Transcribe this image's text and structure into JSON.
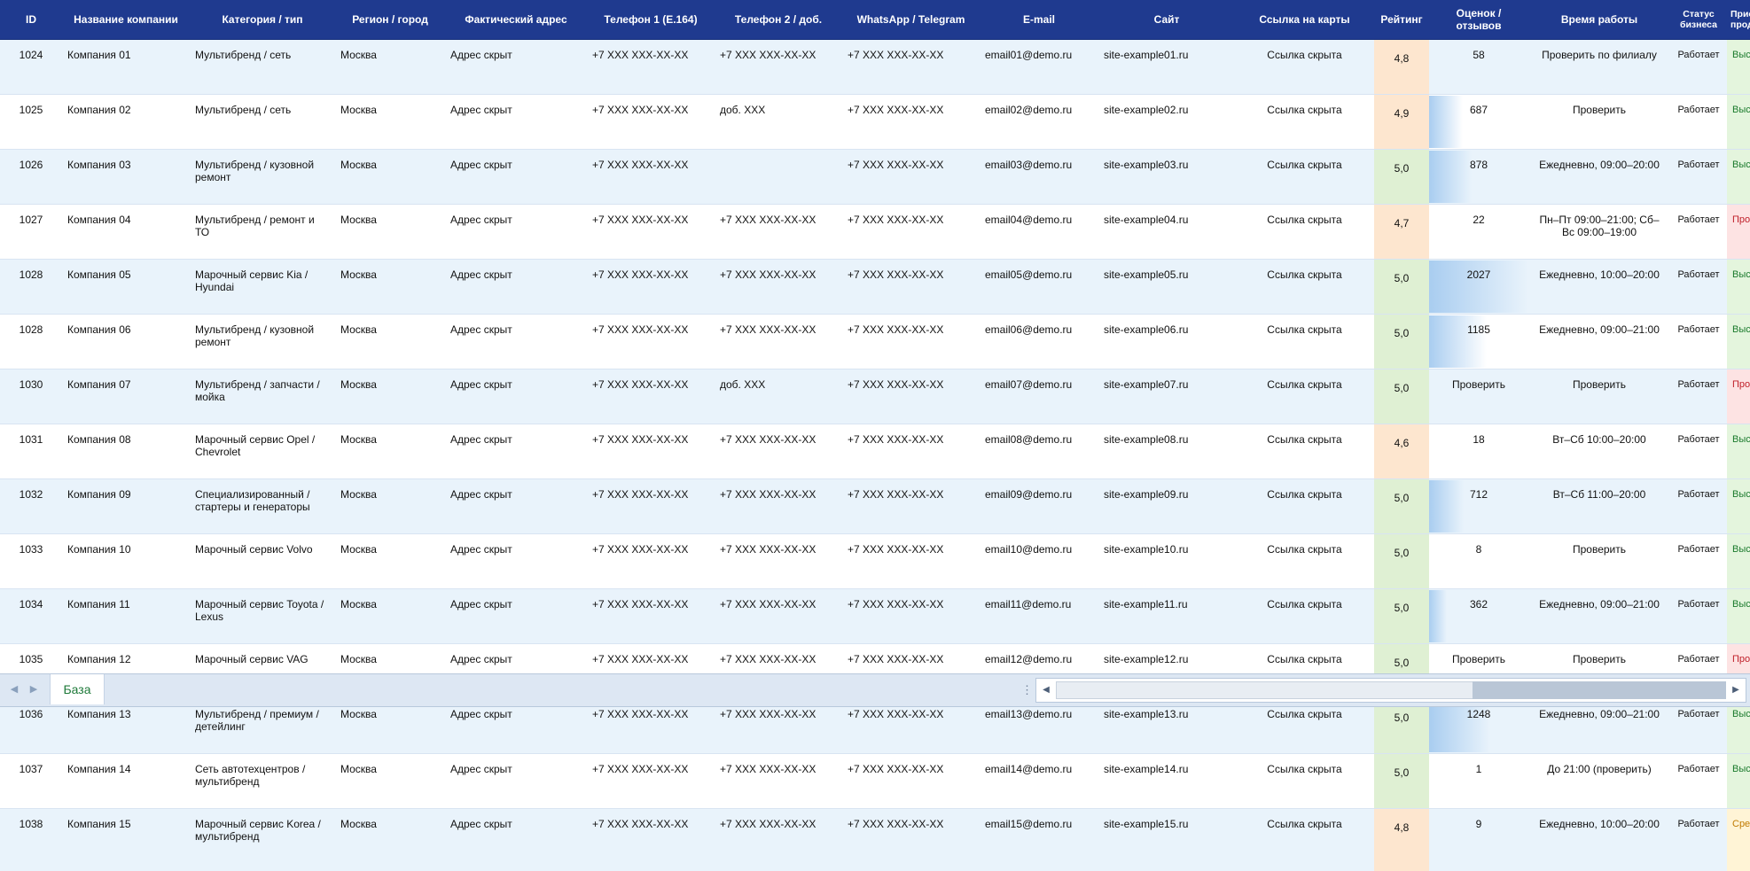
{
  "headers": [
    "ID",
    "Название компании",
    "Категория / тип",
    "Регион / город",
    "Фактический адрес",
    "Телефон 1 (E.164)",
    "Телефон 2 / доб.",
    "WhatsApp / Telegram",
    "E-mail",
    "Сайт",
    "Ссылка на карты",
    "Рейтинг",
    "Оценок / отзывов",
    "Время работы",
    "Статус бизнеса",
    "Приоритет продаж"
  ],
  "rows": [
    {
      "id": "1024",
      "name": "Компания 01",
      "category": "Мультибренд / сеть",
      "region": "Москва",
      "address": "Адрес скрыт",
      "phone1": "+7 XXX XXX-XX-XX",
      "phone2": "+7 XXX XXX-XX-XX",
      "messenger": "+7 XXX XXX-XX-XX",
      "email": "email01@demo.ru",
      "site": "site-example01.ru",
      "map": "Ссылка скрыта",
      "rating": "4,8",
      "rating_level": "warn",
      "reviews": "58",
      "reviews_fill": 0.0,
      "hours": "Проверить по филиалу",
      "status": "Работает",
      "priority": "Высокий",
      "priority_level": "high"
    },
    {
      "id": "1025",
      "name": "Компания 02",
      "category": "Мультибренд / сеть",
      "region": "Москва",
      "address": "Адрес скрыт",
      "phone1": "+7 XXX XXX-XX-XX",
      "phone2": "доб. XXX",
      "messenger": "+7 XXX XXX-XX-XX",
      "email": "email02@demo.ru",
      "site": "site-example02.ru",
      "map": "Ссылка скрыта",
      "rating": "4,9",
      "rating_level": "warn",
      "reviews": "687",
      "reviews_fill": 0.34,
      "hours": "Проверить",
      "status": "Работает",
      "priority": "Высокий",
      "priority_level": "high"
    },
    {
      "id": "1026",
      "name": "Компания 03",
      "category": "Мультибренд / кузовной ремонт",
      "region": "Москва",
      "address": "Адрес скрыт",
      "phone1": "+7 XXX XXX-XX-XX",
      "phone2": "",
      "messenger": "+7 XXX XXX-XX-XX",
      "email": "email03@demo.ru",
      "site": "site-example03.ru",
      "map": "Ссылка скрыта",
      "rating": "5,0",
      "rating_level": "good",
      "reviews": "878",
      "reviews_fill": 0.43,
      "hours": "Ежедневно, 09:00–20:00",
      "status": "Работает",
      "priority": "Высокий",
      "priority_level": "high"
    },
    {
      "id": "1027",
      "name": "Компания 04",
      "category": "Мультибренд / ремонт и ТО",
      "region": "Москва",
      "address": "Адрес скрыт",
      "phone1": "+7 XXX XXX-XX-XX",
      "phone2": "+7 XXX XXX-XX-XX",
      "messenger": "+7 XXX XXX-XX-XX",
      "email": "email04@demo.ru",
      "site": "site-example04.ru",
      "map": "Ссылка скрыта",
      "rating": "4,7",
      "rating_level": "warn",
      "reviews": "22",
      "reviews_fill": 0.0,
      "hours": "Пн–Пт 09:00–21:00; Сб–Вс 09:00–19:00",
      "status": "Работает",
      "priority": "Проверить",
      "priority_level": "check"
    },
    {
      "id": "1028",
      "name": "Компания 05",
      "category": "Марочный сервис Kia / Hyundai",
      "region": "Москва",
      "address": "Адрес скрыт",
      "phone1": "+7 XXX XXX-XX-XX",
      "phone2": "+7 XXX XXX-XX-XX",
      "messenger": "+7 XXX XXX-XX-XX",
      "email": "email05@demo.ru",
      "site": "site-example05.ru",
      "map": "Ссылка скрыта",
      "rating": "5,0",
      "rating_level": "good",
      "reviews": "2027",
      "reviews_fill": 1.0,
      "hours": "Ежедневно, 10:00–20:00",
      "status": "Работает",
      "priority": "Высокий",
      "priority_level": "high"
    },
    {
      "id": "1028",
      "name": "Компания 06",
      "category": "Мультибренд / кузовной ремонт",
      "region": "Москва",
      "address": "Адрес скрыт",
      "phone1": "+7 XXX XXX-XX-XX",
      "phone2": "+7 XXX XXX-XX-XX",
      "messenger": "+7 XXX XXX-XX-XX",
      "email": "email06@demo.ru",
      "site": "site-example06.ru",
      "map": "Ссылка скрыта",
      "rating": "5,0",
      "rating_level": "good",
      "reviews": "1185",
      "reviews_fill": 0.58,
      "hours": "Ежедневно, 09:00–21:00",
      "status": "Работает",
      "priority": "Высокий",
      "priority_level": "high"
    },
    {
      "id": "1030",
      "name": "Компания 07",
      "category": "Мультибренд / запчасти / мойка",
      "region": "Москва",
      "address": "Адрес скрыт",
      "phone1": "+7 XXX XXX-XX-XX",
      "phone2": "доб. XXX",
      "messenger": "+7 XXX XXX-XX-XX",
      "email": "email07@demo.ru",
      "site": "site-example07.ru",
      "map": "Ссылка скрыта",
      "rating": "5,0",
      "rating_level": "good",
      "reviews": "Проверить",
      "reviews_fill": 0.0,
      "hours": "Проверить",
      "status": "Работает",
      "priority": "Проверить",
      "priority_level": "check"
    },
    {
      "id": "1031",
      "name": "Компания 08",
      "category": "Марочный сервис Opel / Chevrolet",
      "region": "Москва",
      "address": "Адрес скрыт",
      "phone1": "+7 XXX XXX-XX-XX",
      "phone2": "+7 XXX XXX-XX-XX",
      "messenger": "+7 XXX XXX-XX-XX",
      "email": "email08@demo.ru",
      "site": "site-example08.ru",
      "map": "Ссылка скрыта",
      "rating": "4,6",
      "rating_level": "warn",
      "reviews": "18",
      "reviews_fill": 0.0,
      "hours": "Вт–Сб 10:00–20:00",
      "status": "Работает",
      "priority": "Высокий",
      "priority_level": "high"
    },
    {
      "id": "1032",
      "name": "Компания 09",
      "category": "Специализированный / стартеры и генераторы",
      "region": "Москва",
      "address": "Адрес скрыт",
      "phone1": "+7 XXX XXX-XX-XX",
      "phone2": "+7 XXX XXX-XX-XX",
      "messenger": "+7 XXX XXX-XX-XX",
      "email": "email09@demo.ru",
      "site": "site-example09.ru",
      "map": "Ссылка скрыта",
      "rating": "5,0",
      "rating_level": "good",
      "reviews": "712",
      "reviews_fill": 0.35,
      "hours": "Вт–Сб 11:00–20:00",
      "status": "Работает",
      "priority": "Высокий",
      "priority_level": "high"
    },
    {
      "id": "1033",
      "name": "Компания 10",
      "category": "Марочный сервис Volvo",
      "region": "Москва",
      "address": "Адрес скрыт",
      "phone1": "+7 XXX XXX-XX-XX",
      "phone2": "+7 XXX XXX-XX-XX",
      "messenger": "+7 XXX XXX-XX-XX",
      "email": "email10@demo.ru",
      "site": "site-example10.ru",
      "map": "Ссылка скрыта",
      "rating": "5,0",
      "rating_level": "good",
      "reviews": "8",
      "reviews_fill": 0.0,
      "hours": "Проверить",
      "status": "Работает",
      "priority": "Высокий",
      "priority_level": "high"
    },
    {
      "id": "1034",
      "name": "Компания 11",
      "category": "Марочный сервис Toyota / Lexus",
      "region": "Москва",
      "address": "Адрес скрыт",
      "phone1": "+7 XXX XXX-XX-XX",
      "phone2": "+7 XXX XXX-XX-XX",
      "messenger": "+7 XXX XXX-XX-XX",
      "email": "email11@demo.ru",
      "site": "site-example11.ru",
      "map": "Ссылка скрыта",
      "rating": "5,0",
      "rating_level": "good",
      "reviews": "362",
      "reviews_fill": 0.18,
      "hours": "Ежедневно, 09:00–21:00",
      "status": "Работает",
      "priority": "Высокий",
      "priority_level": "high"
    },
    {
      "id": "1035",
      "name": "Компания 12",
      "category": "Марочный сервис VAG",
      "region": "Москва",
      "address": "Адрес скрыт",
      "phone1": "+7 XXX XXX-XX-XX",
      "phone2": "+7 XXX XXX-XX-XX",
      "messenger": "+7 XXX XXX-XX-XX",
      "email": "email12@demo.ru",
      "site": "site-example12.ru",
      "map": "Ссылка скрыта",
      "rating": "5,0",
      "rating_level": "good",
      "reviews": "Проверить",
      "reviews_fill": 0.0,
      "hours": "Проверить",
      "status": "Работает",
      "priority": "Проверить",
      "priority_level": "check"
    },
    {
      "id": "1036",
      "name": "Компания 13",
      "category": "Мультибренд / премиум / детейлинг",
      "region": "Москва",
      "address": "Адрес скрыт",
      "phone1": "+7 XXX XXX-XX-XX",
      "phone2": "+7 XXX XXX-XX-XX",
      "messenger": "+7 XXX XXX-XX-XX",
      "email": "email13@demo.ru",
      "site": "site-example13.ru",
      "map": "Ссылка скрыта",
      "rating": "5,0",
      "rating_level": "good",
      "reviews": "1248",
      "reviews_fill": 0.62,
      "hours": "Ежедневно, 09:00–21:00",
      "status": "Работает",
      "priority": "Высокий",
      "priority_level": "high"
    },
    {
      "id": "1037",
      "name": "Компания 14",
      "category": "Сеть автотехцентров / мультибренд",
      "region": "Москва",
      "address": "Адрес скрыт",
      "phone1": "+7 XXX XXX-XX-XX",
      "phone2": "+7 XXX XXX-XX-XX",
      "messenger": "+7 XXX XXX-XX-XX",
      "email": "email14@demo.ru",
      "site": "site-example14.ru",
      "map": "Ссылка скрыта",
      "rating": "5,0",
      "rating_level": "good",
      "reviews": "1",
      "reviews_fill": 0.0,
      "hours": "До 21:00 (проверить)",
      "status": "Работает",
      "priority": "Высокий",
      "priority_level": "high"
    },
    {
      "id": "1038",
      "name": "Компания 15",
      "category": "Марочный сервис Korea / мультибренд",
      "region": "Москва",
      "address": "Адрес скрыт",
      "phone1": "+7 XXX XXX-XX-XX",
      "phone2": "+7 XXX XXX-XX-XX",
      "messenger": "+7 XXX XXX-XX-XX",
      "email": "email15@demo.ru",
      "site": "site-example15.ru",
      "map": "Ссылка скрыта",
      "rating": "4,8",
      "rating_level": "warn",
      "reviews": "9",
      "reviews_fill": 0.0,
      "hours": "Ежедневно, 10:00–20:00",
      "status": "Работает",
      "priority": "Средний",
      "priority_level": "mid"
    }
  ],
  "sheet_tab": "База",
  "colors": {
    "header_bg": "#1f3a8f",
    "rating_good": "#dff0d3",
    "rating_warn": "#fde6cf",
    "priority_high": "#1a7a2c",
    "priority_check": "#c0202a",
    "priority_mid": "#c07a00",
    "databar": "#a9cdf0"
  },
  "icons": {
    "prev_sheet": "triangle-left-icon",
    "next_sheet": "triangle-right-icon",
    "splitter": "vertical-dots-icon",
    "scroll_left": "arrow-left-icon",
    "scroll_right": "arrow-right-icon"
  }
}
